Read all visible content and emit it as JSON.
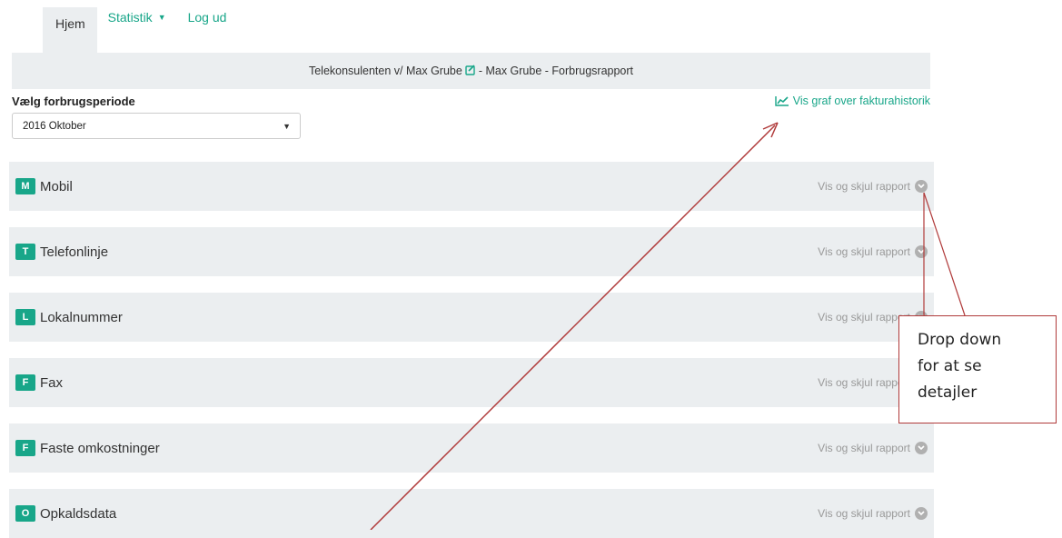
{
  "nav": {
    "items": [
      {
        "label": "Hjem"
      },
      {
        "label": "Statistik"
      },
      {
        "label": "Log ud"
      }
    ]
  },
  "banner": {
    "company": "Telekonsulenten v/ Max Grube",
    "rest": "- Max Grube - Forbrugsrapport"
  },
  "period": {
    "label": "Vælg forbrugsperiode",
    "selected": "2016 Oktober"
  },
  "graph_link": "Vis graf over fakturahistorik",
  "sections": [
    {
      "badge": "M",
      "title": "Mobil",
      "toggle": "Vis og skjul rapport"
    },
    {
      "badge": "T",
      "title": "Telefonlinje",
      "toggle": "Vis og skjul rapport"
    },
    {
      "badge": "L",
      "title": "Lokalnummer",
      "toggle": "Vis og skjul rapport"
    },
    {
      "badge": "F",
      "title": "Fax",
      "toggle": "Vis og skjul rapport"
    },
    {
      "badge": "F",
      "title": "Faste omkostninger",
      "toggle": "Vis og skjul rapport"
    },
    {
      "badge": "O",
      "title": "Opkaldsdata",
      "toggle": "Vis og skjul rapport"
    }
  ],
  "annotation": {
    "lines": [
      "Drop down",
      "for at se",
      "detajler"
    ]
  },
  "colors": {
    "accent": "#18a689",
    "panel": "#ebeef0",
    "annotation": "#b03a3a"
  }
}
